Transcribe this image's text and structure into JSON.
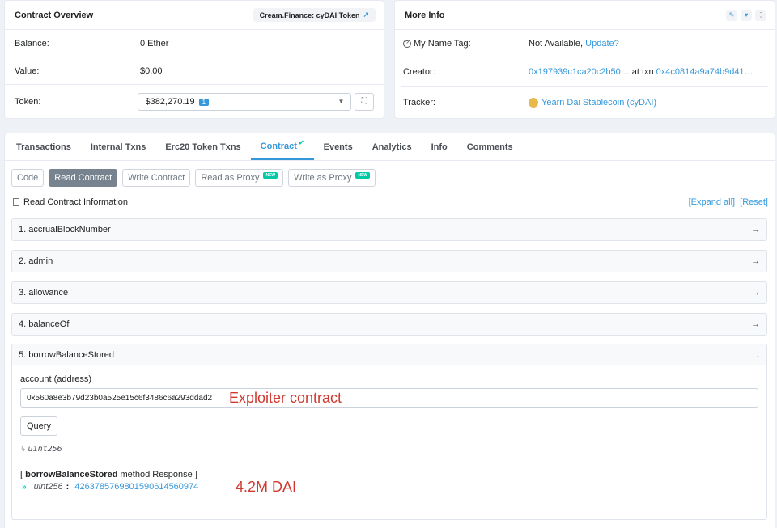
{
  "overview": {
    "title": "Contract Overview",
    "badge": "Cream.Finance: cyDAI Token",
    "balance_label": "Balance:",
    "balance_value": "0 Ether",
    "value_label": "Value:",
    "value_value": "$0.00",
    "token_label": "Token:",
    "token_value": "$382,270.19",
    "token_count": "1"
  },
  "more_info": {
    "title": "More Info",
    "name_tag_label": "My Name Tag:",
    "name_tag_value": "Not Available,",
    "name_tag_link": "Update?",
    "creator_label": "Creator:",
    "creator_address": "0x197939c1ca20c2b50…",
    "creator_at": "at txn",
    "creator_txn": "0x4c0814a9a74b9d41…",
    "tracker_label": "Tracker:",
    "tracker_value": "Yearn Dai Stablecoin (cyDAI)"
  },
  "tabs": [
    "Transactions",
    "Internal Txns",
    "Erc20 Token Txns",
    "Contract",
    "Events",
    "Analytics",
    "Info",
    "Comments"
  ],
  "subtabs": {
    "code": "Code",
    "read": "Read Contract",
    "write": "Write Contract",
    "read_proxy": "Read as Proxy",
    "write_proxy": "Write as Proxy",
    "new_badge": "NEW"
  },
  "read_info": {
    "title": "Read Contract Information",
    "expand_all": "[Expand all]",
    "reset": "[Reset]"
  },
  "functions": [
    "1. accrualBlockNumber",
    "2. admin",
    "3. allowance",
    "4. balanceOf",
    "5. borrowBalanceStored"
  ],
  "open_function": {
    "param_label": "account (address)",
    "input_value": "0x560a8e3b79d23b0a525e15c6f3486c6a293ddad2",
    "query_label": "Query",
    "return_type": "uint256",
    "response_open": "[",
    "response_name": "borrowBalanceStored",
    "response_suffix": "method Response ]",
    "response_type": "uint256",
    "response_colon": ":",
    "response_value": "4263785769801590614560974"
  },
  "annotations": {
    "exploiter": "Exploiter contract",
    "amount": "4.2M DAI"
  },
  "colors": {
    "accent": "#3498db",
    "annotation": "#d0392f",
    "new_badge": "#00c9a7"
  }
}
